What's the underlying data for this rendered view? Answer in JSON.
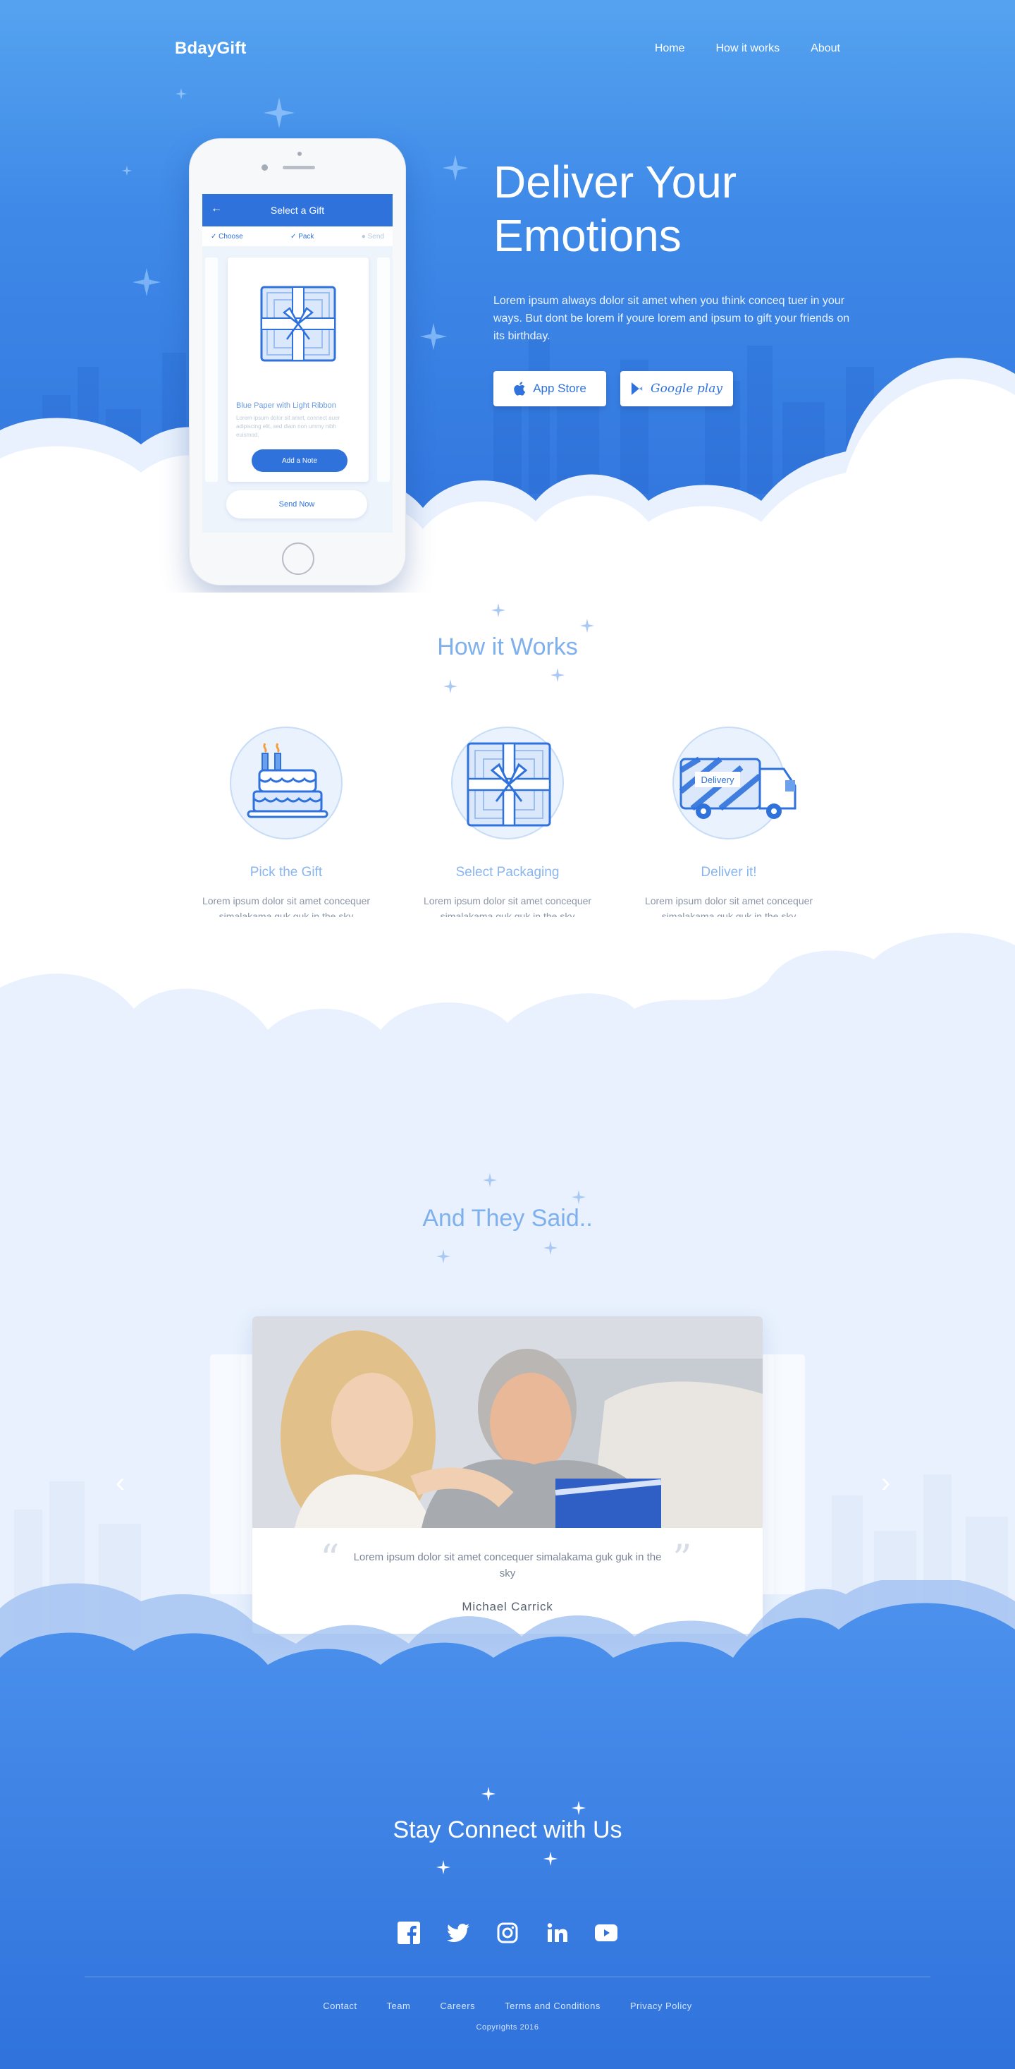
{
  "nav": {
    "brand": "BdayGift",
    "links": [
      "Home",
      "How it works",
      "About"
    ]
  },
  "hero": {
    "title_line1": "Deliver Your",
    "title_line2": "Emotions",
    "text": "Lorem ipsum always dolor sit amet when you think conceq tuer in your ways. But dont be lorem if youre lorem and ipsum to gift your friends on its birthday.",
    "app_store_label": "App Store",
    "google_play_label": "Google play"
  },
  "phone": {
    "screen_title": "Select a Gift",
    "steps": [
      "Choose",
      "Pack",
      "Send"
    ],
    "gift_name": "Blue Paper with Light Ribbon",
    "gift_desc": "Lorem ipsum dolor sit amet, connect auer adipiscing elit, sed diam non ummy nibh euismod.",
    "note_button": "Add a Note",
    "send_button": "Send Now"
  },
  "how": {
    "title": "How it Works",
    "steps": [
      {
        "label": "Pick the Gift",
        "desc_line1": "Lorem ipsum dolor sit amet concequer",
        "desc_line2": "simalakama guk guk in the sky"
      },
      {
        "label": "Select Packaging",
        "desc_line1": "Lorem ipsum dolor sit amet concequer",
        "desc_line2": "simalakama guk guk in the sky"
      },
      {
        "label": "Deliver it!",
        "desc_line1": "Lorem ipsum dolor sit amet concequer",
        "desc_line2": "simalakama guk guk in the sky"
      }
    ],
    "truck_label": "Delivery"
  },
  "testimonials": {
    "title": "And They Said..",
    "quote": "Lorem ipsum dolor sit amet concequer simalakama guk guk in the sky",
    "author": "Michael Carrick"
  },
  "footer": {
    "title": "Stay Connect with Us",
    "socials": [
      "facebook-icon",
      "twitter-icon",
      "instagram-icon",
      "linkedin-icon",
      "youtube-icon"
    ],
    "links": [
      "Contact",
      "Team",
      "Careers",
      "Terms and Conditions",
      "Privacy Policy"
    ],
    "copyright": "Copyrights 2016"
  },
  "colors": {
    "primary": "#2f72dc",
    "sky": "#55a3f0",
    "light_text": "#7fb0ee",
    "bg_light": "#e8f1fd"
  }
}
